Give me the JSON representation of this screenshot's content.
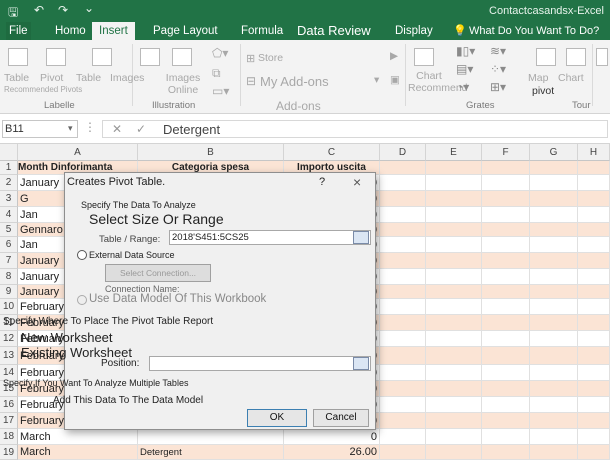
{
  "window": {
    "title": "Contactcasandsx-Excel"
  },
  "tabs": [
    "File",
    "Homo",
    "Insert",
    "Page Layout",
    "Formula",
    "Data Review",
    "Display"
  ],
  "tell_me": "What Do You Want To Do?",
  "ribbon": {
    "tables": {
      "items": [
        "Table",
        "Pivot",
        "Table",
        "Recommended Pivots"
      ],
      "group": "Labelle"
    },
    "illustrations": {
      "items": [
        "Images",
        "Images Online"
      ],
      "group": "Illustration"
    },
    "addins": {
      "store": "Store",
      "my_addins": "My Add-ons",
      "group": "Add-ons"
    },
    "charts": {
      "recommend": "Chart Recommend",
      "map": "Map",
      "chart": "Chart",
      "pivot": "pivot",
      "group": "Grates"
    },
    "tour": {
      "group": "Tour"
    }
  },
  "formula_bar": {
    "name_box": "B11",
    "value": "Detergent"
  },
  "columns": [
    "A",
    "B",
    "C",
    "D",
    "E",
    "F",
    "G",
    "H"
  ],
  "sheet_rows": {
    "headers": [
      "Month Dinforimanta",
      "Categoria spesa",
      "Importo uscita"
    ],
    "row_numbers": [
      "1",
      "2",
      "3",
      "4",
      "5",
      "6",
      "7",
      "8",
      "9",
      "10",
      "11",
      "12",
      "13",
      "14",
      "15",
      "16",
      "17",
      "18",
      "19"
    ],
    "col_a": [
      "January",
      "G",
      "Jan",
      "Gennaro",
      "Jan",
      "January",
      "January",
      "January",
      "February",
      "February",
      "February",
      "February",
      "February",
      "February",
      "February",
      "February",
      "March",
      "March"
    ],
    "col_c": [
      "0",
      "0",
      "0",
      "0",
      "0",
      "0",
      "0",
      "0",
      "0",
      "0",
      "0",
      "0",
      "0",
      "0",
      "0",
      "0",
      "0",
      "26.00"
    ],
    "row19_b": "Detergent"
  },
  "dialog": {
    "title": "Creates Pivot Table.",
    "help": "?",
    "close": "×",
    "specify_data": "Specify The Data To Analyze",
    "select_range": "Select Size Or Range",
    "table_range_label": "Table / Range:",
    "table_range_value": "2018'S451:5CS25",
    "external_source": "External Data Source",
    "select_connection": "Select Connection...",
    "connection_name": "Connection Name:",
    "use_data_model": "Use Data Model Of This Workbook",
    "place_report": "Specify Where To Place The Pivot Table Report",
    "new_worksheet": "New Worksheet",
    "existing_worksheet": "Existing Worksheet",
    "position_label": "Position:",
    "multiple_tables": "Specify If You Want To Analyze Multiple Tables",
    "add_data_model": "Add This Data To The Data Model",
    "ok": "OK",
    "cancel": "Cancel"
  }
}
